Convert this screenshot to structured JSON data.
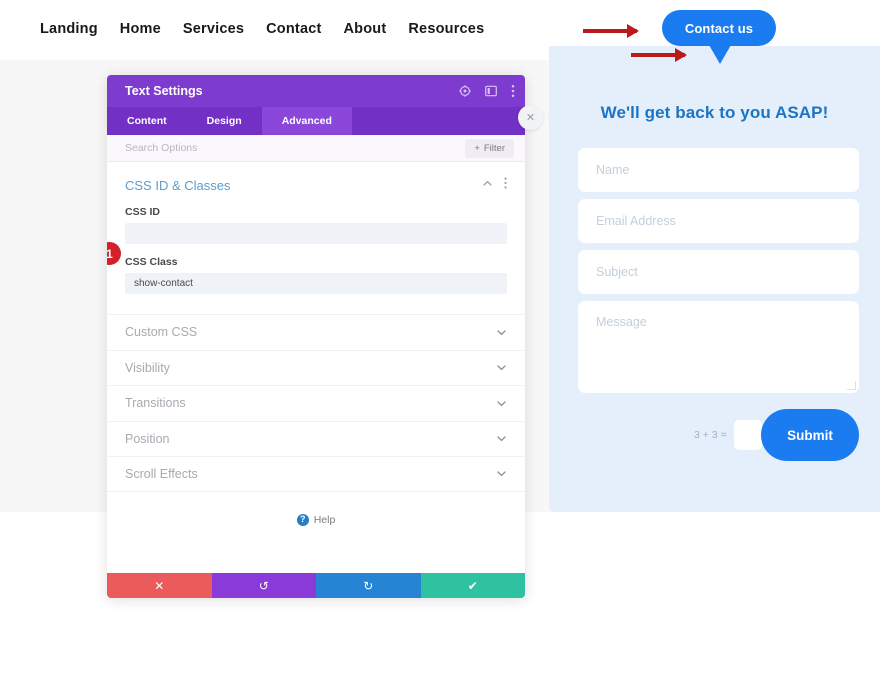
{
  "nav": {
    "items": [
      {
        "label": "Landing"
      },
      {
        "label": "Home"
      },
      {
        "label": "Services"
      },
      {
        "label": "Contact"
      },
      {
        "label": "About"
      },
      {
        "label": "Resources"
      }
    ]
  },
  "contact_button": {
    "label": "Contact us",
    "color": "#1a7cf0"
  },
  "contact_panel": {
    "title": "We'll get back to you ASAP!",
    "title_color": "#1c74c4",
    "background": "#e4effb",
    "fields": [
      {
        "placeholder": "Name"
      },
      {
        "placeholder": "Email Address"
      },
      {
        "placeholder": "Subject"
      },
      {
        "placeholder": "Message"
      }
    ],
    "captcha": {
      "label": "3 + 3 =",
      "value": ""
    },
    "submit_label": "Submit"
  },
  "modal": {
    "title": "Text Settings",
    "header_color": "#7e3bd0",
    "header_icons": [
      {
        "name": "target-icon"
      },
      {
        "name": "panel-layout-icon"
      },
      {
        "name": "more-vertical-icon"
      }
    ],
    "tabs": [
      {
        "label": "Content",
        "active": false
      },
      {
        "label": "Design",
        "active": false
      },
      {
        "label": "Advanced",
        "active": true
      }
    ],
    "search": {
      "placeholder": "Search Options",
      "value": ""
    },
    "filter_label": "Filter",
    "open_section": {
      "title": "CSS ID & Classes",
      "fields": [
        {
          "label": "CSS ID",
          "value": ""
        },
        {
          "label": "CSS Class",
          "value": "show-contact"
        }
      ],
      "badge": "1",
      "badge_color": "#d3202a"
    },
    "collapsed_sections": [
      {
        "label": "Custom CSS"
      },
      {
        "label": "Visibility"
      },
      {
        "label": "Transitions"
      },
      {
        "label": "Position"
      },
      {
        "label": "Scroll Effects"
      }
    ],
    "help_label": "Help",
    "actions": [
      {
        "name": "cancel",
        "glyph": "✕",
        "color": "#eb5b5b"
      },
      {
        "name": "undo",
        "glyph": "↺",
        "color": "#8a3ad8"
      },
      {
        "name": "redo",
        "glyph": "↻",
        "color": "#2585d4"
      },
      {
        "name": "save",
        "glyph": "✔",
        "color": "#2ec2a0"
      }
    ],
    "close_glyph": "✕"
  },
  "annotations": {
    "arrow_color": "#bb1a1a"
  }
}
